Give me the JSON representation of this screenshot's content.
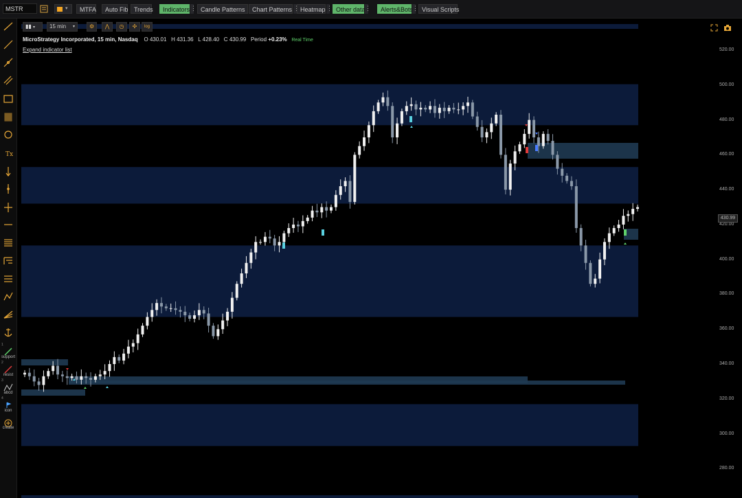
{
  "toolbar": {
    "symbol": "MSTR",
    "buttons": [
      {
        "label": "MTFA",
        "active": false
      },
      {
        "label": "Auto Fib",
        "active": false
      },
      {
        "label": "Trends",
        "active": false
      },
      {
        "label": "Indicators",
        "active": true
      },
      {
        "label": "Candle Patterns",
        "active": false
      },
      {
        "label": "Chart Patterns",
        "active": false
      },
      {
        "label": "Heatmap",
        "active": false
      },
      {
        "label": "Other data",
        "active": true
      },
      {
        "label": "Alerts&Bots",
        "active": true
      },
      {
        "label": "Visual Scripts",
        "active": false
      }
    ]
  },
  "chart_toolbar": {
    "interval": "15 min"
  },
  "legend": {
    "name": "MicroStrategy Incorporated, 15 min, Nasdaq",
    "open_label": "O",
    "open": "430.01",
    "high_label": "H",
    "high": "431.36",
    "low_label": "L",
    "low": "428.40",
    "close_label": "C",
    "close": "430.99",
    "period_label": "Period",
    "period": "+0.23%",
    "realtime": "Real Time",
    "expand": "Expand indicator list"
  },
  "drawing_tools": {
    "numbered": [
      {
        "num": "1",
        "label": "support"
      },
      {
        "num": "2",
        "label": "resist"
      },
      {
        "num": "3",
        "label": "abcd"
      },
      {
        "num": "4",
        "label": "icon"
      }
    ],
    "create_label": "create"
  },
  "colors": {
    "accent": "#f5a623",
    "active_green": "#5fb56a",
    "zone_navy": "#0c1b3a",
    "zone_teal": "#1f3a52",
    "bull": "#f0f0f0",
    "bear": "#8a98a8"
  },
  "chart_data": {
    "type": "candlestick",
    "y_ticks": [
      "520.00",
      "500.00",
      "480.00",
      "460.00",
      "440.00",
      "420.00",
      "400.00",
      "380.00",
      "360.00",
      "340.00",
      "320.00",
      "300.00",
      "280.00"
    ],
    "ylim": [
      275,
      535
    ],
    "last_price": "430.99",
    "zones": [
      {
        "from": 500.5,
        "to": 477
      },
      {
        "from": 453,
        "to": 432
      },
      {
        "from": 408,
        "to": 367
      },
      {
        "from": 317,
        "to": 293
      }
    ],
    "closes": [
      335,
      333,
      330,
      328,
      333,
      336,
      339,
      334,
      333,
      332,
      333,
      331,
      333,
      332,
      331,
      333,
      334,
      336,
      340,
      344,
      342,
      346,
      350,
      352,
      357,
      362,
      367,
      371,
      375,
      373,
      372,
      372,
      371,
      370,
      368,
      366,
      368,
      371,
      369,
      362,
      356,
      360,
      365,
      370,
      378,
      386,
      392,
      398,
      404,
      410,
      410,
      413,
      412,
      408,
      410,
      415,
      418,
      420,
      419,
      422,
      424,
      428,
      427,
      430,
      428,
      430,
      437,
      442,
      445,
      433,
      460,
      465,
      470,
      477,
      485,
      490,
      493,
      488,
      470,
      478,
      485,
      488,
      489,
      486,
      487,
      486,
      488,
      484,
      487,
      485,
      487,
      486,
      486,
      488,
      490,
      482,
      476,
      470,
      473,
      478,
      483,
      460,
      440,
      455,
      462,
      466,
      472,
      480,
      470,
      465,
      472,
      468,
      460,
      452,
      448,
      445,
      442,
      418,
      408,
      398,
      386,
      389,
      400,
      410,
      415,
      418,
      420,
      425,
      426,
      429,
      430
    ]
  }
}
